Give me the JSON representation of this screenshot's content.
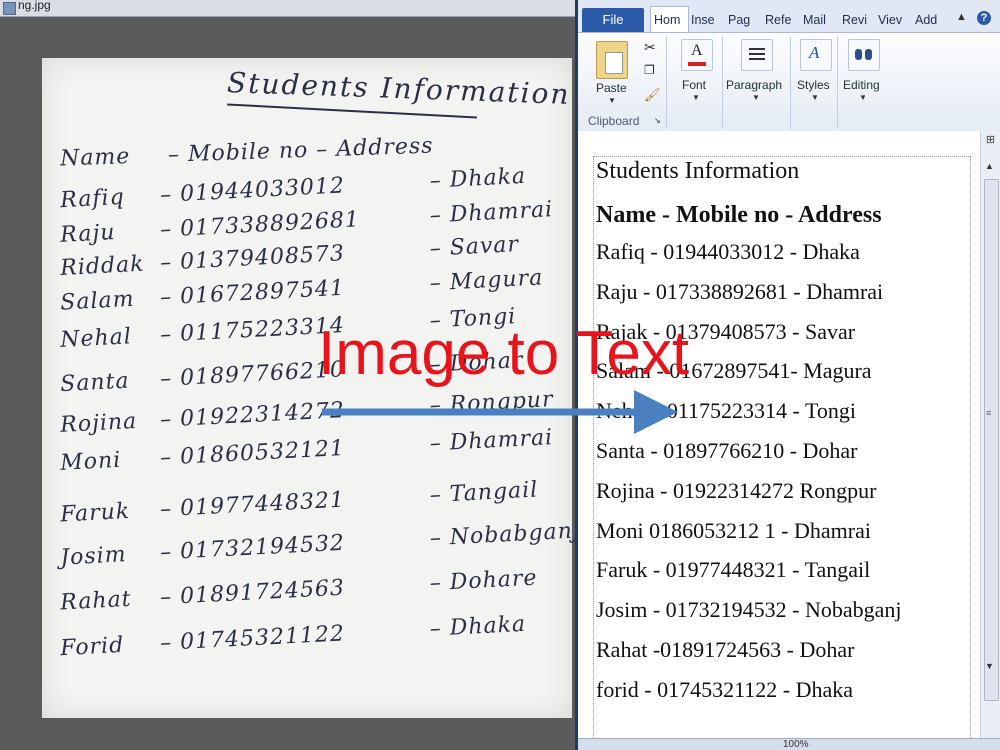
{
  "viewer": {
    "title": "ng.jpg",
    "handwritten_title": "Students Information",
    "handwritten_header": [
      "Name",
      "Mobile no",
      "Address"
    ],
    "handwritten_rows": [
      [
        "Rafiq",
        "01944033012",
        "Dhaka"
      ],
      [
        "Raju",
        "017338892681",
        "Dhamrai"
      ],
      [
        "Riddak",
        "01379408573",
        "Savar"
      ],
      [
        "Salam",
        "01672897541",
        "Magura"
      ],
      [
        "Nehal",
        "01175223314",
        "Tongi"
      ],
      [
        "Santa",
        "01897766210",
        "Dohar"
      ],
      [
        "Rojina",
        "01922314272",
        "Rongpur"
      ],
      [
        "Moni",
        "01860532121",
        "Dhamrai"
      ],
      [
        "Faruk",
        "01977448321",
        "Tangail"
      ],
      [
        "Josim",
        "01732194532",
        "Nobabganj"
      ],
      [
        "Rahat",
        "01891724563",
        "Dohare"
      ],
      [
        "Forid",
        "01745321122",
        "Dhaka"
      ]
    ]
  },
  "overlay": {
    "label": "Image to Text",
    "label_color": "#e8141c",
    "arrow_color": "#4a7fc0"
  },
  "word": {
    "tabs": [
      "File",
      "Hom",
      "Inse",
      "Pag",
      "Refe",
      "Mail",
      "Revi",
      "Viev",
      "Add"
    ],
    "ribbon": {
      "paste": "Paste",
      "clipboard": "Clipboard",
      "font": "Font",
      "paragraph": "Paragraph",
      "styles": "Styles",
      "editing": "Editing"
    },
    "document": {
      "title": "Students Information",
      "heading": "Name - Mobile no - Address",
      "lines": [
        "Rafiq - 01944033012 - Dhaka",
        "Raju - 017338892681 - Dhamrai",
        "Rajak - 01379408573 - Savar",
        "Salam - 01672897541- Magura",
        "Nehal - 01175223314 - Tongi",
        "Santa - 01897766210 - Dohar",
        "Rojina - 01922314272 Rongpur",
        "Moni 0186053212 1 - Dhamrai",
        "Faruk - 01977448321 - Tangail",
        "Josim - 01732194532 - Nobabganj",
        "Rahat -01891724563 - Dohar",
        "forid - 01745321122 - Dhaka"
      ]
    },
    "status_zoom": "100%",
    "accent": "#2a5aa8"
  }
}
